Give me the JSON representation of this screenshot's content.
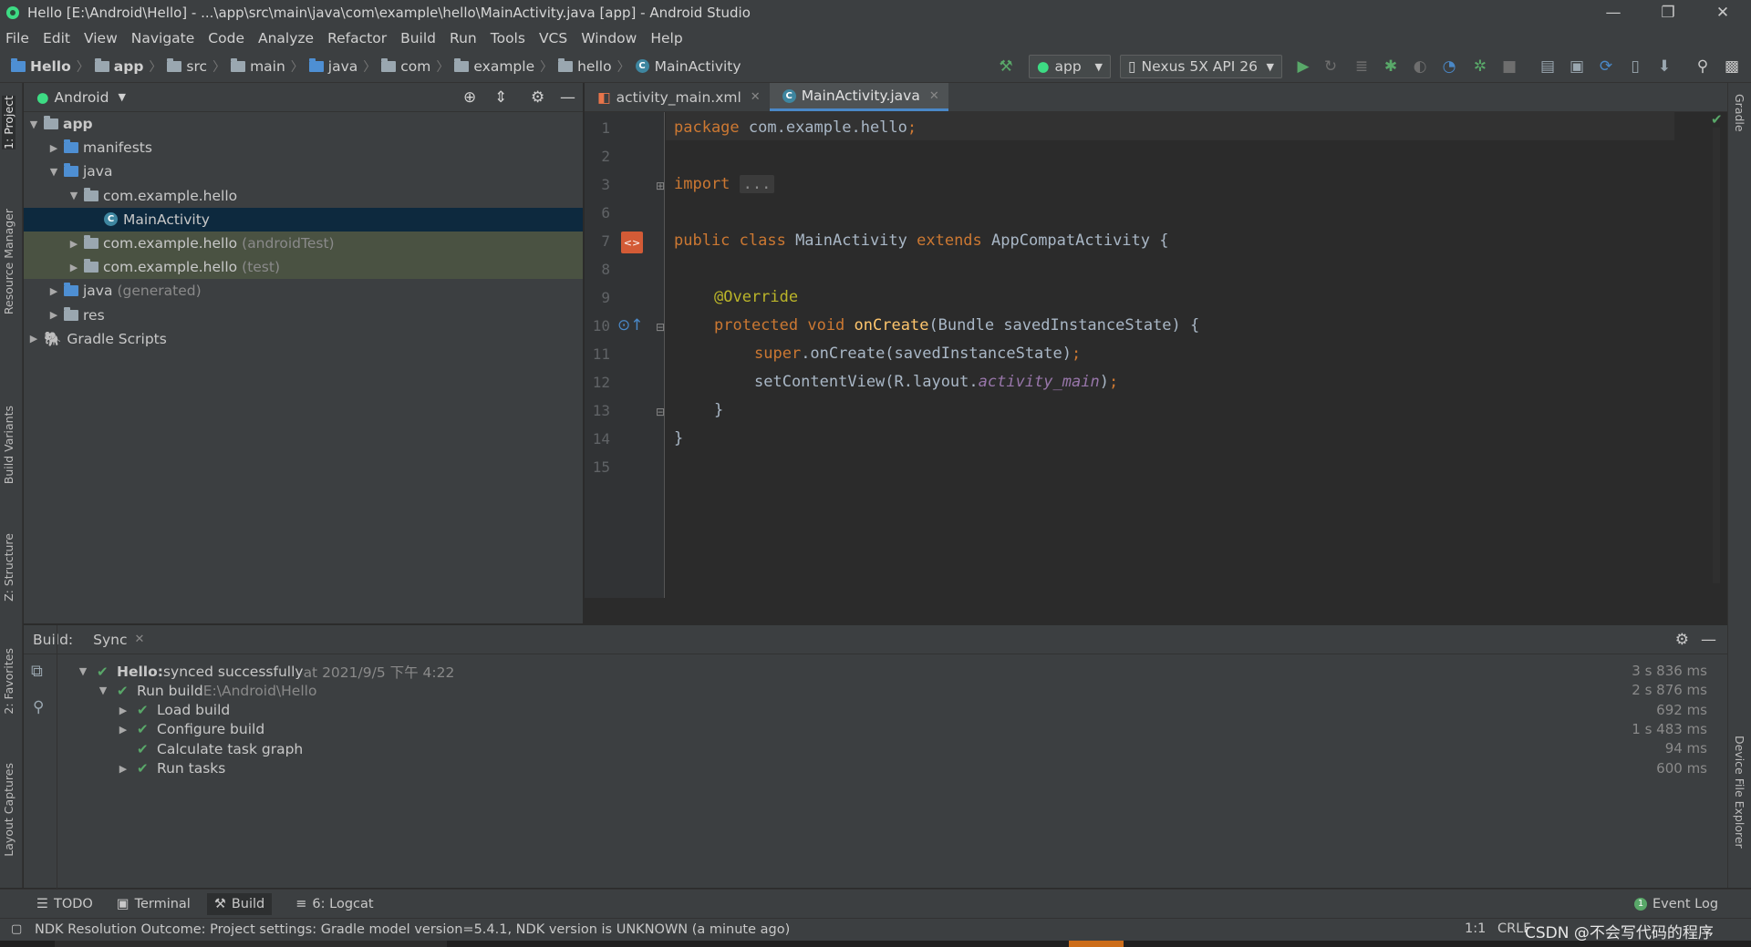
{
  "window": {
    "title": "Hello [E:\\Android\\Hello] - ...\\app\\src\\main\\java\\com\\example\\hello\\MainActivity.java [app] - Android Studio",
    "minimize": "—",
    "restore": "❐",
    "close": "✕"
  },
  "menu": [
    "File",
    "Edit",
    "View",
    "Navigate",
    "Code",
    "Analyze",
    "Refactor",
    "Build",
    "Run",
    "Tools",
    "VCS",
    "Window",
    "Help"
  ],
  "breadcrumb": [
    "Hello",
    "app",
    "src",
    "main",
    "java",
    "com",
    "example",
    "hello",
    "MainActivity"
  ],
  "toolbar": {
    "run_config": "app",
    "device": "Nexus 5X API 26"
  },
  "left_tool_tabs": [
    "1: Project",
    "Resource Manager",
    "Build Variants",
    "Z: Structure",
    "2: Favorites",
    "Layout Captures"
  ],
  "right_tool_tabs": [
    "Gradle",
    "Device File Explorer"
  ],
  "project": {
    "view": "Android",
    "tree": [
      {
        "label": "app",
        "muted": "",
        "level": 0,
        "arrow": "▼",
        "icon": "module"
      },
      {
        "label": "manifests",
        "muted": "",
        "level": 1,
        "arrow": "▶",
        "icon": "folder-blue"
      },
      {
        "label": "java",
        "muted": "",
        "level": 1,
        "arrow": "▼",
        "icon": "folder-blue"
      },
      {
        "label": "com.example.hello",
        "muted": "",
        "level": 2,
        "arrow": "▼",
        "icon": "package"
      },
      {
        "label": "MainActivity",
        "muted": "",
        "level": 3,
        "arrow": "",
        "icon": "class",
        "selected": true
      },
      {
        "label": "com.example.hello",
        "muted": "(androidTest)",
        "level": 2,
        "arrow": "▶",
        "icon": "package",
        "tinted": true
      },
      {
        "label": "com.example.hello",
        "muted": "(test)",
        "level": 2,
        "arrow": "▶",
        "icon": "package",
        "tinted": true
      },
      {
        "label": "java",
        "muted": "(generated)",
        "level": 1,
        "arrow": "▶",
        "icon": "folder-gen"
      },
      {
        "label": "res",
        "muted": "",
        "level": 1,
        "arrow": "▶",
        "icon": "folder-res"
      },
      {
        "label": "Gradle Scripts",
        "muted": "",
        "level": 0,
        "arrow": "▶",
        "icon": "gradle"
      }
    ]
  },
  "editor": {
    "tabs": [
      {
        "label": "activity_main.xml",
        "active": false
      },
      {
        "label": "MainActivity.java",
        "active": true
      }
    ],
    "line_numbers": [
      "1",
      "2",
      "3",
      "6",
      "7",
      "8",
      "9",
      "10",
      "11",
      "12",
      "13",
      "14",
      "15"
    ],
    "code": {
      "l1_kw": "package",
      "l1_rest": " com.example.hello",
      "l1_semi": ";",
      "l3_kw": "import",
      "l3_fold": "...",
      "l7_kw1": "public class",
      "l7_name": " MainActivity ",
      "l7_kw2": "extends",
      "l7_rest": " AppCompatActivity {",
      "l9_an": "@Override",
      "l10_kw": "protected void",
      "l10_fn": "onCreate",
      "l10_rest": "(Bundle savedInstanceState) {",
      "l11_kw": "super",
      "l11_rest": ".onCreate(savedInstanceState)",
      "l11_semi": ";",
      "l12_pre": "setContentView(R.layout.",
      "l12_it": "activity_main",
      "l12_post": ")",
      "l12_semi": ";",
      "l13": "}",
      "l14": "}"
    }
  },
  "build": {
    "header_label": "Build:",
    "tab": "Sync",
    "rows": [
      {
        "label": "Hello:",
        "rest": " synced successfully",
        "muted": " at 2021/9/5 下午 4:22",
        "time": "3 s 836 ms",
        "level": 0,
        "arrow": "▼",
        "bold": true
      },
      {
        "label": "Run build",
        "rest": "",
        "muted": " E:\\Android\\Hello",
        "time": "2 s 876 ms",
        "level": 1,
        "arrow": "▼"
      },
      {
        "label": "Load build",
        "rest": "",
        "muted": "",
        "time": "692 ms",
        "level": 2,
        "arrow": "▶"
      },
      {
        "label": "Configure build",
        "rest": "",
        "muted": "",
        "time": "1 s 483 ms",
        "level": 2,
        "arrow": "▶"
      },
      {
        "label": "Calculate task graph",
        "rest": "",
        "muted": "",
        "time": "94 ms",
        "level": 2,
        "arrow": ""
      },
      {
        "label": "Run tasks",
        "rest": "",
        "muted": "",
        "time": "600 ms",
        "level": 2,
        "arrow": "▶"
      }
    ]
  },
  "bottom_tabs": [
    {
      "label": "TODO",
      "icon": "☰"
    },
    {
      "label": "Terminal",
      "icon": "▣"
    },
    {
      "label": "Build",
      "icon": "⚒",
      "active": true
    },
    {
      "label": "6: Logcat",
      "icon": "≡"
    }
  ],
  "event_log": "Event Log",
  "status": {
    "message": "NDK Resolution Outcome: Project settings: Gradle model version=5.4.1, NDK version is UNKNOWN (a minute ago)",
    "position": "1:1",
    "line_sep": "CRLF",
    "watermark": "CSDN @不会写代码的程序"
  },
  "colors": {
    "accent": "#4a88c7",
    "keyword": "#cc7832",
    "annotation": "#bbb529",
    "function": "#ffc66d",
    "success": "#59a869",
    "selection": "#0d293e"
  }
}
